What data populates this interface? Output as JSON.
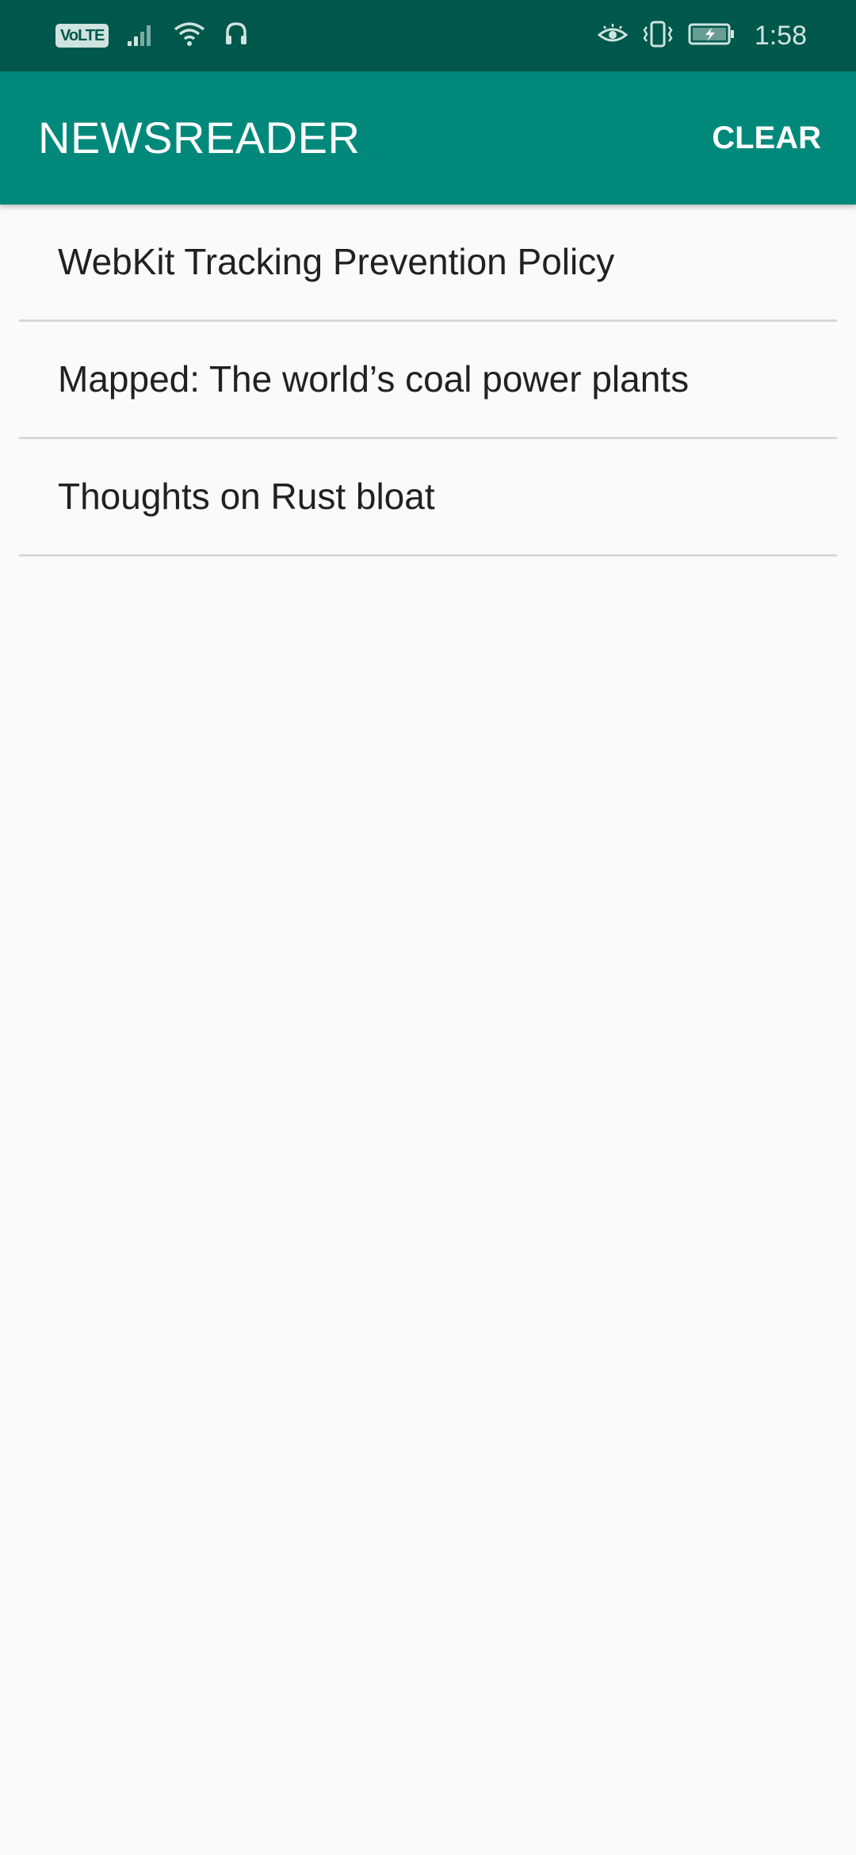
{
  "status_bar": {
    "volte_label": "VoLTE",
    "time": "1:58",
    "icons": [
      "volte-icon",
      "signal-icon",
      "wifi-icon",
      "headset-icon",
      "eye-comfort-icon",
      "vibrate-icon",
      "battery-charging-icon"
    ]
  },
  "app_bar": {
    "title": "NEWSREADER",
    "clear_label": "CLEAR",
    "color": "#00897b",
    "status_color": "#00574b"
  },
  "articles": [
    {
      "title": "WebKit Tracking Prevention Policy"
    },
    {
      "title": "Mapped: The world’s coal power plants"
    },
    {
      "title": "Thoughts on Rust bloat"
    }
  ]
}
